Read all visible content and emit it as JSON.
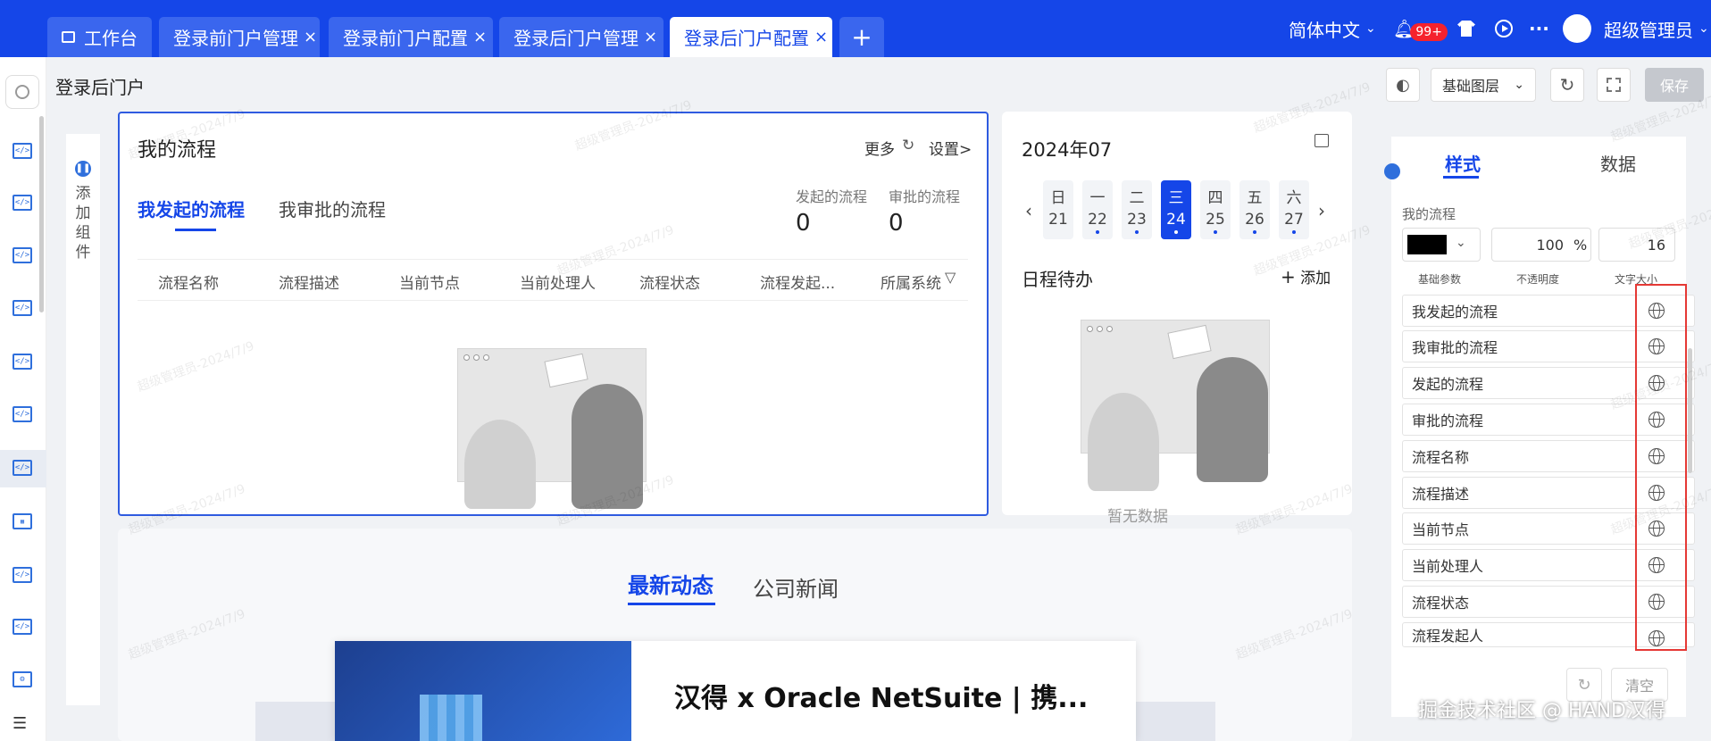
{
  "topbar": {
    "tabs": [
      {
        "label": "工作台",
        "closable": false
      },
      {
        "label": "登录前门户管理",
        "closable": true
      },
      {
        "label": "登录前门户配置",
        "closable": true
      },
      {
        "label": "登录后门户管理",
        "closable": true
      },
      {
        "label": "登录后门户配置",
        "closable": true,
        "active": true
      }
    ],
    "add_tab": "+",
    "close_glyph": "×",
    "language": "简体中文",
    "notifications_badge": "99+",
    "more": "···",
    "user_name": "超级管理员"
  },
  "page": {
    "title": "登录后门户"
  },
  "add_component": {
    "label": "添加组件"
  },
  "workflow": {
    "title": "我的流程",
    "more": "更多",
    "settings": "设置>",
    "tabs": [
      "我发起的流程",
      "我审批的流程"
    ],
    "stats": [
      {
        "label": "发起的流程",
        "value": "0"
      },
      {
        "label": "审批的流程",
        "value": "0"
      }
    ],
    "columns": [
      "流程名称",
      "流程描述",
      "当前节点",
      "当前处理人",
      "流程状态",
      "流程发起...",
      "所属系统"
    ]
  },
  "calendar": {
    "title": "2024年07",
    "days": [
      {
        "week": "日",
        "day": "21",
        "dot": false
      },
      {
        "week": "一",
        "day": "22",
        "dot": true
      },
      {
        "week": "二",
        "day": "23",
        "dot": true
      },
      {
        "week": "三",
        "day": "24",
        "dot": true,
        "active": true
      },
      {
        "week": "四",
        "day": "25",
        "dot": true
      },
      {
        "week": "五",
        "day": "26",
        "dot": true
      },
      {
        "week": "六",
        "day": "27",
        "dot": true
      }
    ],
    "schedule_title": "日程待办",
    "add": "添加",
    "no_data": "暂无数据"
  },
  "news": {
    "tabs": [
      "最新动态",
      "公司新闻"
    ],
    "headline": "汉得 x Oracle NetSuite | 携..."
  },
  "toolbar": {
    "layer_select": "基础图层",
    "save": "保存"
  },
  "panel": {
    "tabs": [
      "样式",
      "数据"
    ],
    "section_label": "我的流程",
    "color": "#000000",
    "opacity": "100",
    "opacity_unit": "%",
    "font_size": "16",
    "param_labels": [
      "基础参数",
      "不透明度",
      "文字大小"
    ],
    "rows": [
      "我发起的流程",
      "我审批的流程",
      "发起的流程",
      "审批的流程",
      "流程名称",
      "流程描述",
      "当前节点",
      "当前处理人",
      "流程状态",
      "流程发起人"
    ],
    "clear": "清空"
  },
  "watermark": "超级管理员-2024/7/9",
  "footer_watermark": "掘金技术社区 @ HAND汉得",
  "colors": {
    "primary": "#1546e8",
    "highlight_border": "#e53935"
  }
}
